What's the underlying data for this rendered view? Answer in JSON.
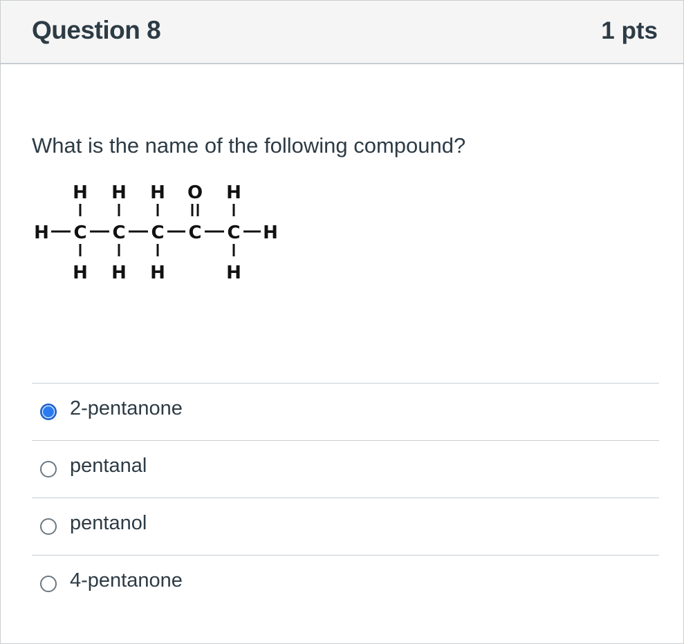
{
  "question": {
    "title": "Question 8",
    "points": "1 pts",
    "prompt": "What is the name of the following compound?"
  },
  "structure": {
    "top_row": [
      "H",
      "H",
      "H",
      "O",
      "H"
    ],
    "middle_row": [
      "H",
      "C",
      "C",
      "C",
      "C",
      "C",
      "H"
    ],
    "bottom_row": [
      "H",
      "H",
      "H",
      "H"
    ]
  },
  "answers": [
    {
      "label": "2-pentanone",
      "selected": true
    },
    {
      "label": "pentanal",
      "selected": false
    },
    {
      "label": "pentanol",
      "selected": false
    },
    {
      "label": "4-pentanone",
      "selected": false
    }
  ]
}
